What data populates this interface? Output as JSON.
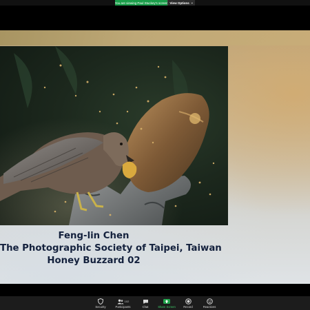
{
  "banner": {
    "text": "You are viewing Paul Stuckey's screen",
    "view_options": "View Options",
    "view_options_caret": "⌄"
  },
  "caption": {
    "author": "Feng-lin Chen",
    "society": "The Photographic Society of Taipei, Taiwan",
    "title": "Honey Buzzard 02"
  },
  "toolbar": {
    "security": "Security",
    "participants": "Participants",
    "participant_count": "102",
    "chat": "Chat",
    "share_screen": "Share Screen",
    "record": "Record",
    "reactions": "Reactions"
  },
  "colors": {
    "banner_green": "#1a9e4a",
    "share_green": "#20a34b",
    "caption_text": "#14213d",
    "toolbar_bg": "#1c1c1c"
  },
  "icons": [
    "shield-icon",
    "participants-icon",
    "chat-icon",
    "share-screen-icon",
    "record-icon",
    "reactions-icon"
  ]
}
